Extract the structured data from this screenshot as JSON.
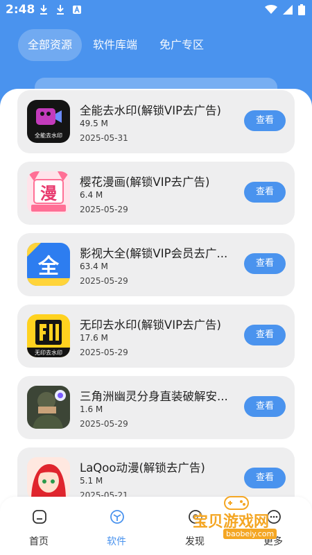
{
  "status_bar": {
    "time": "2:48",
    "icons_left": [
      "download-icon",
      "download-icon",
      "font-a-icon"
    ],
    "icons_right": [
      "wifi-icon",
      "signal-icon",
      "battery-icon"
    ]
  },
  "tabs": [
    {
      "label": "全部资源",
      "active": true
    },
    {
      "label": "软件库端",
      "active": false
    },
    {
      "label": "免广专区",
      "active": false
    }
  ],
  "apps": [
    {
      "name": "全能去水印(解锁VIP去广告)",
      "size": "49.5 M",
      "date": "2025-05-31",
      "icon": "watermark-remover-icon",
      "icon_caption": "全能去水印",
      "button": "查看"
    },
    {
      "name": "樱花漫画(解锁VIP去广告)",
      "size": "6.4 M",
      "date": "2025-05-29",
      "icon": "sakura-comic-icon",
      "icon_caption": "漫",
      "button": "查看"
    },
    {
      "name": "影视大全(解锁VIP会员去广...",
      "size": "63.4 M",
      "date": "2025-05-29",
      "icon": "video-collection-icon",
      "icon_caption": "全",
      "button": "查看"
    },
    {
      "name": "无印去水印(解锁VIP去广告)",
      "size": "17.6 M",
      "date": "2025-05-29",
      "icon": "wuyin-watermark-icon",
      "icon_caption": "无印去水印",
      "button": "查看"
    },
    {
      "name": "三角洲幽灵分身直装破解安...",
      "size": "1.6 M",
      "date": "2025-05-29",
      "icon": "delta-force-icon",
      "icon_caption": "",
      "button": "查看"
    },
    {
      "name": "LaQoo动漫(解锁去广告)",
      "size": "5.1 M",
      "date": "2025-05-21",
      "icon": "laqoo-anime-icon",
      "icon_caption": "",
      "button": "查看"
    }
  ],
  "bottom_nav": [
    {
      "label": "首页",
      "icon": "home-icon",
      "active": false
    },
    {
      "label": "软件",
      "icon": "software-box-icon",
      "active": true
    },
    {
      "label": "发现",
      "icon": "discover-icon",
      "active": false
    },
    {
      "label": "更多",
      "icon": "more-icon",
      "active": false
    }
  ],
  "watermark": {
    "text": "宝贝游戏网",
    "url": "baobeiy.com"
  },
  "colors": {
    "primary": "#4a93ee",
    "card_bg": "#eeeeef",
    "watermark": "#f4a623"
  }
}
